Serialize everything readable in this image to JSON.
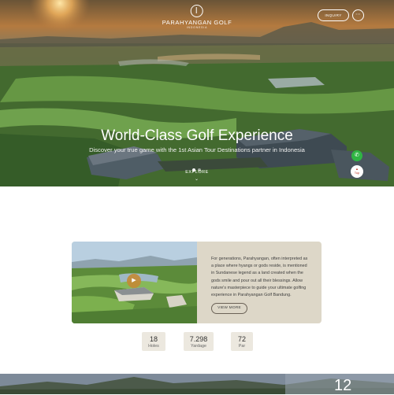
{
  "brand": {
    "name": "PARAHYANGAN GOLF",
    "sub": "INDONESIA"
  },
  "header": {
    "inquiry_label": "INQUIRY",
    "menu_icon": "more-icon"
  },
  "hero": {
    "title": "World-Class Golf Experience",
    "subtitle": "Discover your true game with the 1st Asian Tour Destinations partner in Indonesia",
    "explore_label": "EXPLORE",
    "slides": 2,
    "active_slide": 1
  },
  "floating": {
    "whatsapp_icon": "whatsapp-icon",
    "top_label": "Top"
  },
  "about": {
    "text": "For generations, Parahyangan, often interpreted as a place where hyangs or gods reside, is mentioned in Sundanese legend as a land created when the gods smile and pour out all their blessings. Allow nature's masterpiece to guide your ultimate golfing experience in Parahyangan Golf Bandung.",
    "cta_label": "VIEW MORE"
  },
  "stats": [
    {
      "value": "18",
      "label": "Holes"
    },
    {
      "value": "7.298",
      "label": "Yardage"
    },
    {
      "value": "72",
      "label": "Par"
    }
  ],
  "next_section": {
    "number": "12"
  },
  "colors": {
    "accent": "#c48934",
    "card_bg": "#ddd7c8",
    "stat_bg": "#ece8df",
    "whatsapp": "#2fb543"
  }
}
